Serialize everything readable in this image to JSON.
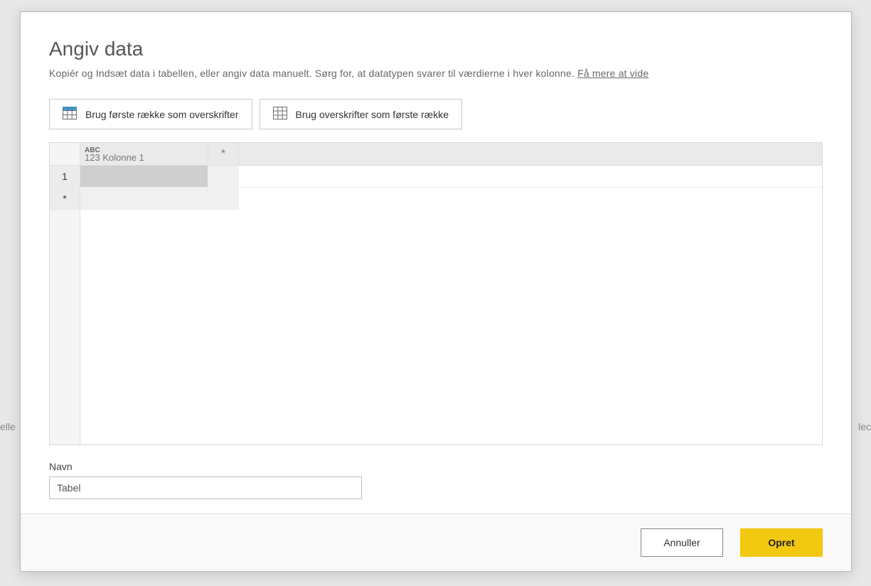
{
  "bg": {
    "left_fragment": "elle",
    "right_fragment": "lec"
  },
  "dialog": {
    "title": "Angiv data",
    "subtitle_main": "Kopiér og Indsæt data i tabellen, eller angiv data manuelt. Sørg for, at datatypen svarer til værdierne i hver kolonne. ",
    "subtitle_link": "Få mere at vide"
  },
  "toolbar": {
    "first_row_headers": "Brug første række som overskrifter",
    "headers_first_row": "Brug overskrifter som første række"
  },
  "grid": {
    "col_type_label": "ABC",
    "col_type_sub": "123",
    "col_name": "Kolonne 1",
    "add_col_marker": "*",
    "row_1_num": "1",
    "add_row_marker": "*"
  },
  "name_field": {
    "label": "Navn",
    "value": "Tabel"
  },
  "footer": {
    "cancel": "Annuller",
    "create": "Opret"
  }
}
